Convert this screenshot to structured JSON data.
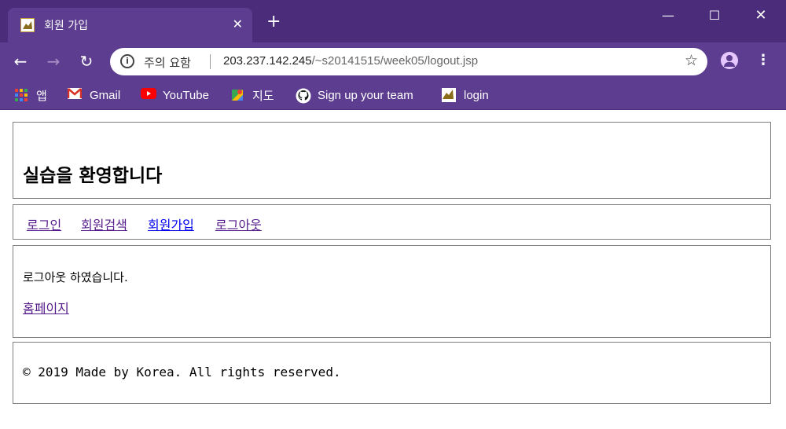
{
  "browser": {
    "tab": {
      "title": "회원 가입",
      "close_label": "✕",
      "favicon": "site-favicon"
    },
    "new_tab_label": "+",
    "window_controls": {
      "minimize": "—",
      "maximize": "☐",
      "close": "✕"
    },
    "nav": {
      "back": "←",
      "forward": "→",
      "reload": "↻"
    },
    "omnibox": {
      "info_glyph": "i",
      "security_label": "주의 요함",
      "url_host": "203.237.142.245",
      "url_path": "/~s20141515/week05/logout.jsp"
    },
    "star_glyph": "☆",
    "menu_glyph": "⋮",
    "bookmarks": [
      {
        "label": "앱",
        "icon": "apps-icon"
      },
      {
        "label": "Gmail",
        "icon": "gmail-icon"
      },
      {
        "label": "YouTube",
        "icon": "youtube-icon"
      },
      {
        "label": "지도",
        "icon": "maps-icon"
      },
      {
        "label": "Sign up your team",
        "icon": "github-icon"
      },
      {
        "label": "login",
        "icon": "login-icon"
      }
    ]
  },
  "page": {
    "header_title": "실습을 환영합니다",
    "nav_links": [
      {
        "label": "로그인",
        "state": "visited"
      },
      {
        "label": "회원검색",
        "state": "visited"
      },
      {
        "label": "회원가입",
        "state": "unvisited"
      },
      {
        "label": "로그아웃",
        "state": "visited"
      }
    ],
    "content": {
      "message": "로그아웃 하였습니다.",
      "home_link": "홈페이지"
    },
    "footer": "© 2019 Made by Korea. All rights reserved."
  },
  "colors": {
    "chrome_dark": "#4a2c7a",
    "chrome": "#5d3d8f",
    "visited_link": "#551a8b",
    "unvisited_link": "#0000ee"
  }
}
